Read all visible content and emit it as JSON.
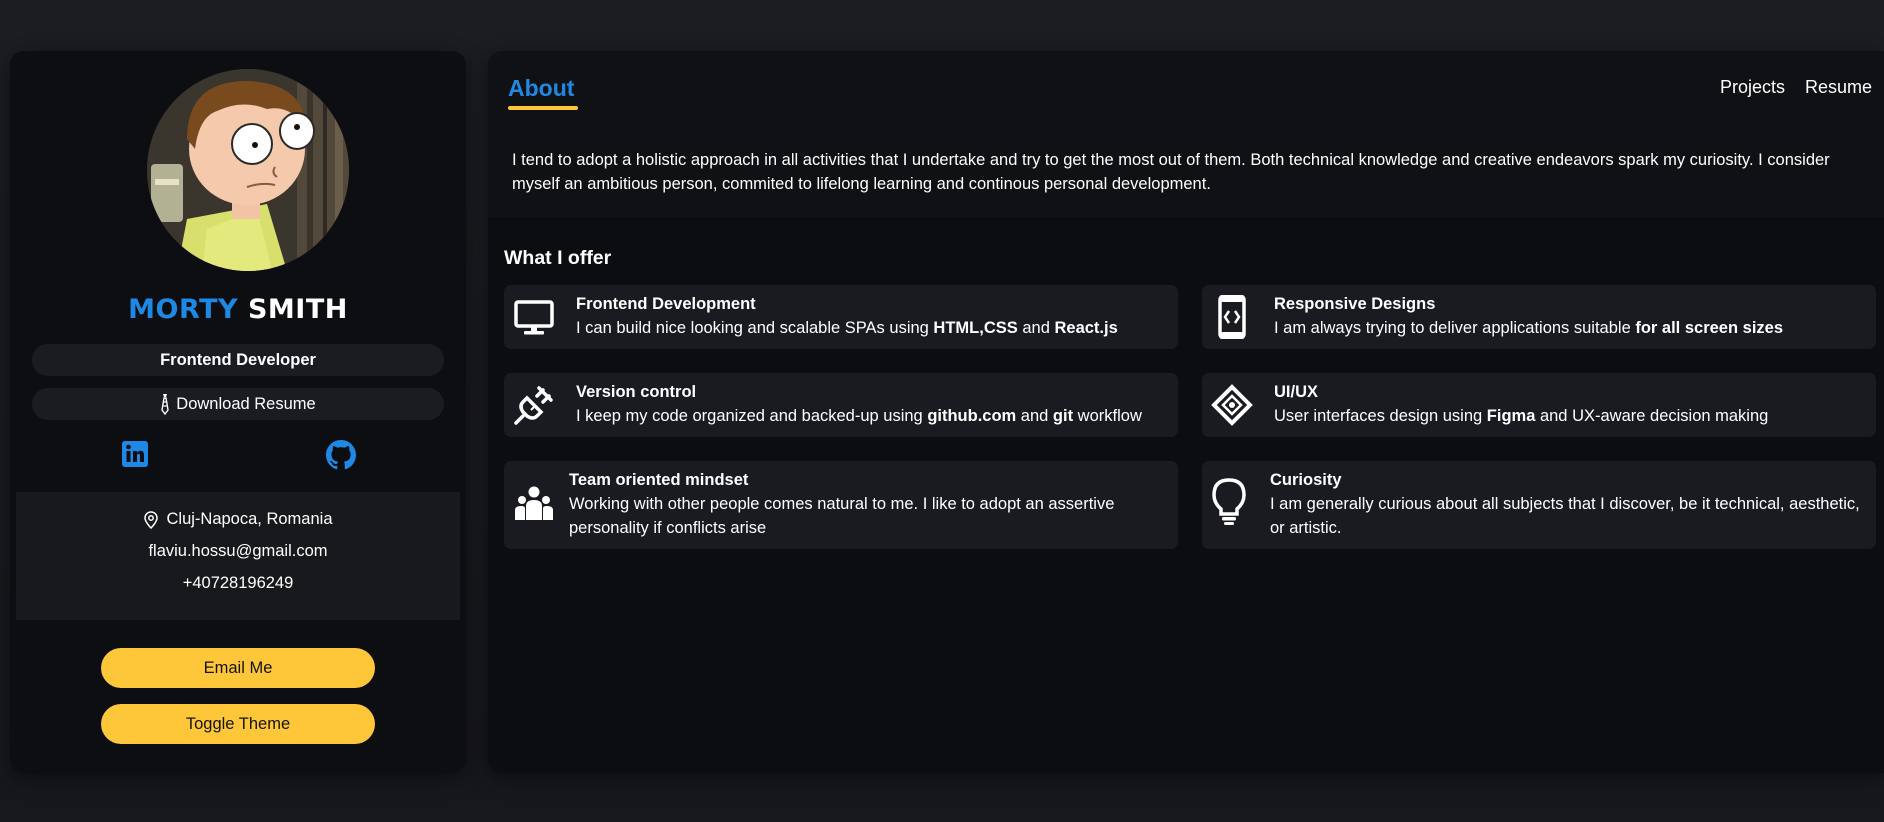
{
  "profile": {
    "first_name": "MORTY",
    "last_name": "SMITH",
    "role": "Frontend Developer",
    "download_resume": "Download Resume"
  },
  "social": {
    "linkedin_icon": "linkedin-icon",
    "github_icon": "github-icon"
  },
  "contact": {
    "location": "Cluj-Napoca, Romania",
    "email": "flaviu.hossu@gmail.com",
    "phone": "+40728196249"
  },
  "buttons": {
    "email_me": "Email Me",
    "toggle_theme": "Toggle Theme"
  },
  "nav": {
    "about": "About",
    "projects": "Projects",
    "resume": "Resume"
  },
  "about": {
    "text": "I tend to adopt a holistic approach in all activities that I undertake and try to get the most out of them. Both technical knowledge and creative endeavors spark my curiosity. I consider myself an ambitious person, commited to lifelong learning and continous personal development."
  },
  "offer": {
    "title": "What I offer",
    "cards": [
      {
        "icon": "monitor-icon",
        "title": "Frontend Development",
        "desc_parts": [
          "I can build nice looking and scalable SPAs using ",
          "HTML",
          ",",
          "CSS",
          " and ",
          "React.js"
        ]
      },
      {
        "icon": "mobile-code-icon",
        "title": "Responsive Designs",
        "desc_parts": [
          "I am always trying to deliver applications suitable ",
          "for all screen sizes"
        ]
      },
      {
        "icon": "plug-icon",
        "title": "Version control",
        "desc_parts": [
          "I keep my code organized and backed-up using ",
          "github.com",
          " and ",
          "git",
          " workflow"
        ]
      },
      {
        "icon": "design-diamond-icon",
        "title": "UI/UX",
        "desc_parts": [
          "User interfaces design using ",
          "Figma",
          " and UX-aware decision making"
        ]
      },
      {
        "icon": "team-icon",
        "title": "Team oriented mindset",
        "desc": "Working with other people comes natural to me. I like to adopt an assertive personality if conflicts arise"
      },
      {
        "icon": "lightbulb-icon",
        "title": "Curiosity",
        "desc": "I am generally curious about all subjects that I discover, be it technical, aesthetic, or artistic."
      }
    ]
  },
  "colors": {
    "accent_blue": "#1e88e5",
    "accent_yellow": "#fec739",
    "card_bg": "#1a1b20",
    "panel_bg": "#0d0e11"
  }
}
